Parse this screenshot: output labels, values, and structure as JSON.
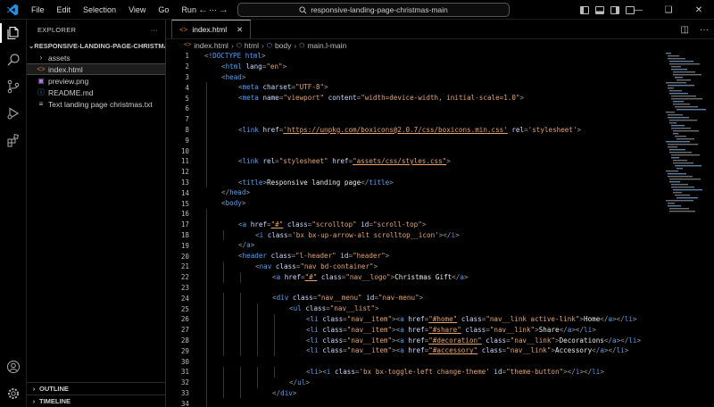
{
  "app": {
    "menu": [
      "File",
      "Edit",
      "Selection",
      "View",
      "Go",
      "Run",
      "···"
    ],
    "search_text": "responsive-landing-page-christmas-main"
  },
  "sidebar": {
    "header": "EXPLORER",
    "root": "RESPONSIVE-LANDING-PAGE-CHRISTMAS...",
    "items": [
      {
        "label": "assets",
        "type": "folder",
        "icon": "chevron-right-icon"
      },
      {
        "label": "index.html",
        "type": "html",
        "icon": "html-file-icon",
        "selected": true
      },
      {
        "label": "preview.png",
        "type": "image",
        "icon": "image-file-icon"
      },
      {
        "label": "README.md",
        "type": "markdown",
        "icon": "info-file-icon"
      },
      {
        "label": "Text landing page christmas.txt",
        "type": "text",
        "icon": "text-file-icon"
      }
    ],
    "outline": "OUTLINE",
    "timeline": "TIMELINE"
  },
  "editor": {
    "tab": "index.html",
    "breadcrumbs": [
      "index.html",
      "html",
      "body",
      "main.l-main"
    ],
    "lines": [
      {
        "n": 1,
        "indent": 0,
        "code": "<!DOCTYPE html>"
      },
      {
        "n": 2,
        "indent": 1,
        "code": "<html lang=\"en\">"
      },
      {
        "n": 3,
        "indent": 1,
        "code": "<head>"
      },
      {
        "n": 4,
        "indent": 2,
        "code": "<meta charset=\"UTF-8\">"
      },
      {
        "n": 5,
        "indent": 2,
        "code": "<meta name=\"viewport\" content=\"width=device-width, initial-scale=1.0\">"
      },
      {
        "n": 6,
        "indent": 0,
        "code": ""
      },
      {
        "n": 7,
        "indent": 0,
        "code": ""
      },
      {
        "n": 8,
        "indent": 2,
        "code": "<link href='https://unpkg.com/boxicons@2.0.7/css/boxicons.min.css' rel='stylesheet'>"
      },
      {
        "n": 9,
        "indent": 0,
        "code": ""
      },
      {
        "n": 10,
        "indent": 0,
        "code": ""
      },
      {
        "n": 11,
        "indent": 2,
        "code": "<link rel=\"stylesheet\" href=\"assets/css/styles.css\">"
      },
      {
        "n": 12,
        "indent": 0,
        "code": ""
      },
      {
        "n": 13,
        "indent": 2,
        "code": "<title>Responsive landing page</title>"
      },
      {
        "n": 14,
        "indent": 1,
        "code": "</head>"
      },
      {
        "n": 15,
        "indent": 1,
        "code": "<body>"
      },
      {
        "n": 16,
        "indent": 0,
        "code": ""
      },
      {
        "n": 17,
        "indent": 2,
        "code": "<a href=\"#\" class=\"scrolltop\" id=\"scroll-top\">"
      },
      {
        "n": 18,
        "indent": 3,
        "code": "<i class='bx bx-up-arrow-alt scrolltop__icon'></i>"
      },
      {
        "n": 19,
        "indent": 2,
        "code": "</a>"
      },
      {
        "n": 20,
        "indent": 2,
        "code": "<header class=\"l-header\" id=\"header\">"
      },
      {
        "n": 21,
        "indent": 3,
        "code": "<nav class=\"nav bd-container\">"
      },
      {
        "n": 22,
        "indent": 4,
        "code": "<a href=\"#\" class=\"nav__logo\">Christmas Gift</a>"
      },
      {
        "n": 23,
        "indent": 0,
        "code": ""
      },
      {
        "n": 24,
        "indent": 4,
        "code": "<div class=\"nav__menu\" id=\"nav-menu\">"
      },
      {
        "n": 25,
        "indent": 5,
        "code": "<ul class=\"nav__list\">"
      },
      {
        "n": 26,
        "indent": 6,
        "code": "<li class=\"nav__item\"><a href=\"#home\" class=\"nav__link active-link\">Home</a></li>"
      },
      {
        "n": 27,
        "indent": 6,
        "code": "<li class=\"nav__item\"><a href=\"#share\" class=\"nav__link\">Share</a></li>"
      },
      {
        "n": 28,
        "indent": 6,
        "code": "<li class=\"nav__item\"><a href=\"#decoration\" class=\"nav__link\">Decorations</a></li>"
      },
      {
        "n": 29,
        "indent": 6,
        "code": "<li class=\"nav__item\"><a href=\"#accessory\" class=\"nav__link\">Accessory</a></li>"
      },
      {
        "n": 30,
        "indent": 0,
        "code": ""
      },
      {
        "n": 31,
        "indent": 6,
        "code": "<li><i class='bx bx-toggle-left change-theme' id=\"theme-button\"></i></li>"
      },
      {
        "n": 32,
        "indent": 5,
        "code": "</ul>"
      },
      {
        "n": 33,
        "indent": 4,
        "code": "</div>"
      },
      {
        "n": 34,
        "indent": 0,
        "code": ""
      }
    ]
  },
  "colors": {
    "tag": "#4ea1ff",
    "attribute": "#cbd7ff",
    "string": "#e6a36b",
    "punctuation": "#9a9a9a",
    "text": "#e8e8e8",
    "background": "#000000"
  }
}
